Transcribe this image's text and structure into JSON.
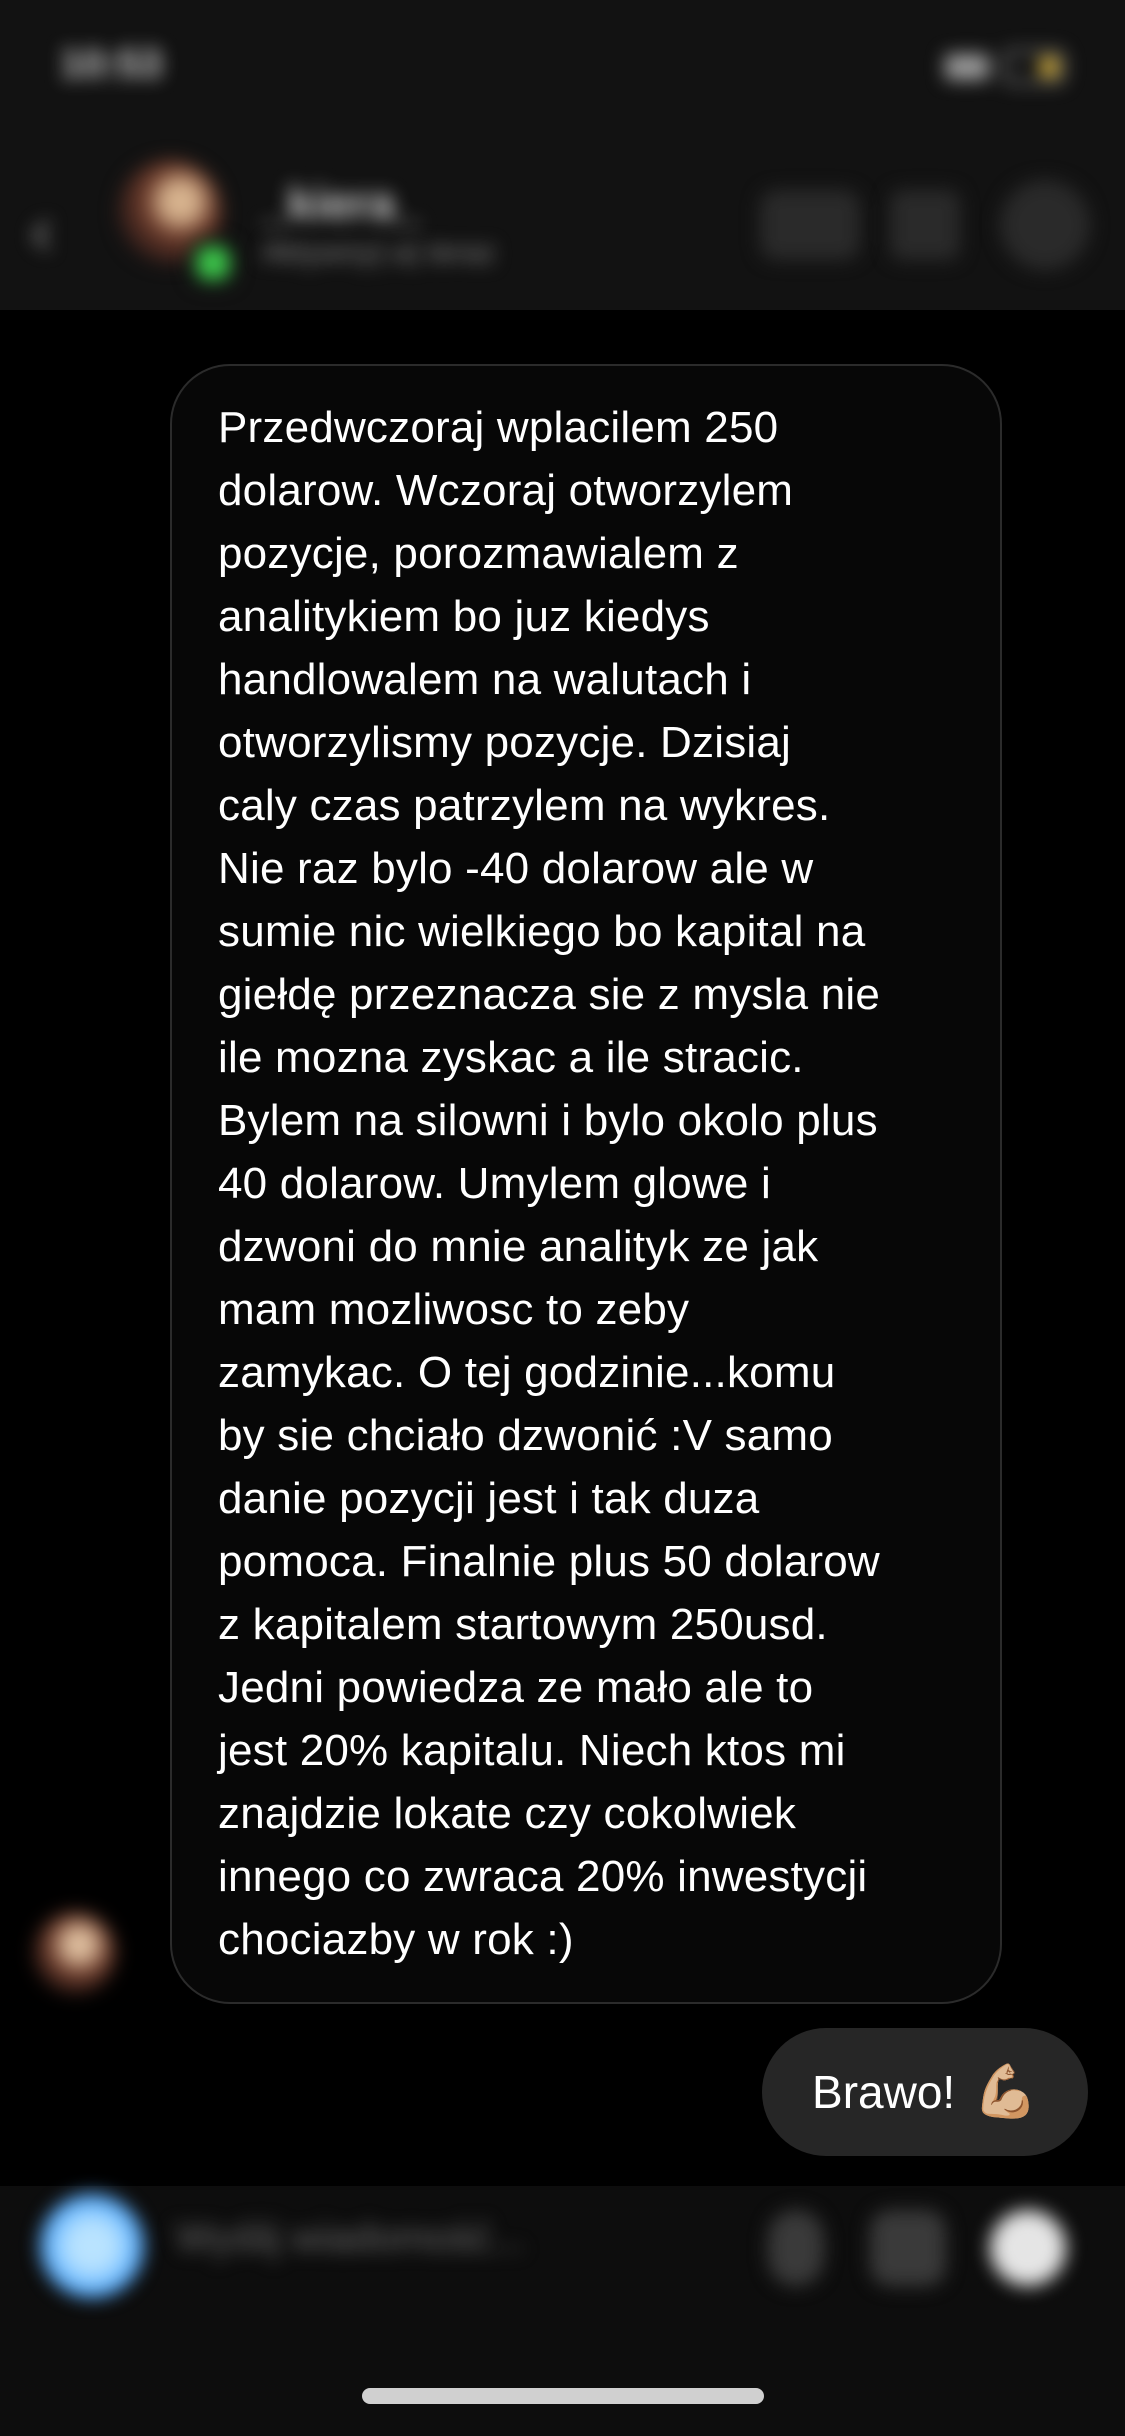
{
  "status_bar": {
    "time": "10:53"
  },
  "header": {
    "back_icon": "chevron-left-icon",
    "contact_name": "_kiera_",
    "contact_status": "Aktywny(-a) teraz"
  },
  "incoming_message": {
    "lines": [
      "Przedwczoraj wplacilem 250",
      "dolarow. Wczoraj otworzylem",
      "pozycje, porozmawialem z",
      "analitykiem bo juz kiedys",
      "handlowalem na walutach i",
      "otworzylismy pozycje. Dzisiaj",
      "caly czas patrzylem na wykres.",
      "Nie raz bylo -40 dolarow ale w",
      "sumie nic wielkiego bo kapital na",
      "giełdę przeznacza sie z mysla nie",
      "ile mozna zyskac a ile stracic.",
      "Bylem na silowni i bylo okolo plus",
      "40 dolarow. Umylem glowe i",
      "dzwoni do mnie analityk ze jak",
      "mam mozliwosc to zeby",
      "zamykac. O tej godzinie...komu",
      "by sie chciało dzwonić :V samo",
      "danie pozycji jest i tak duza",
      "pomoca. Finalnie plus 50 dolarow",
      "z kapitalem startowym 250usd.",
      "Jedni powiedza ze mało ale to",
      "jest 20% kapitalu. Niech ktos mi",
      "znajdzie lokate czy cokolwiek",
      "innego co zwraca 20% inwestycji",
      "chociazby w rok :)"
    ]
  },
  "outgoing_message": {
    "text": "Brawo!",
    "emoji": "💪🏼"
  },
  "composer": {
    "placeholder": "Wyślij wiadomość..."
  }
}
